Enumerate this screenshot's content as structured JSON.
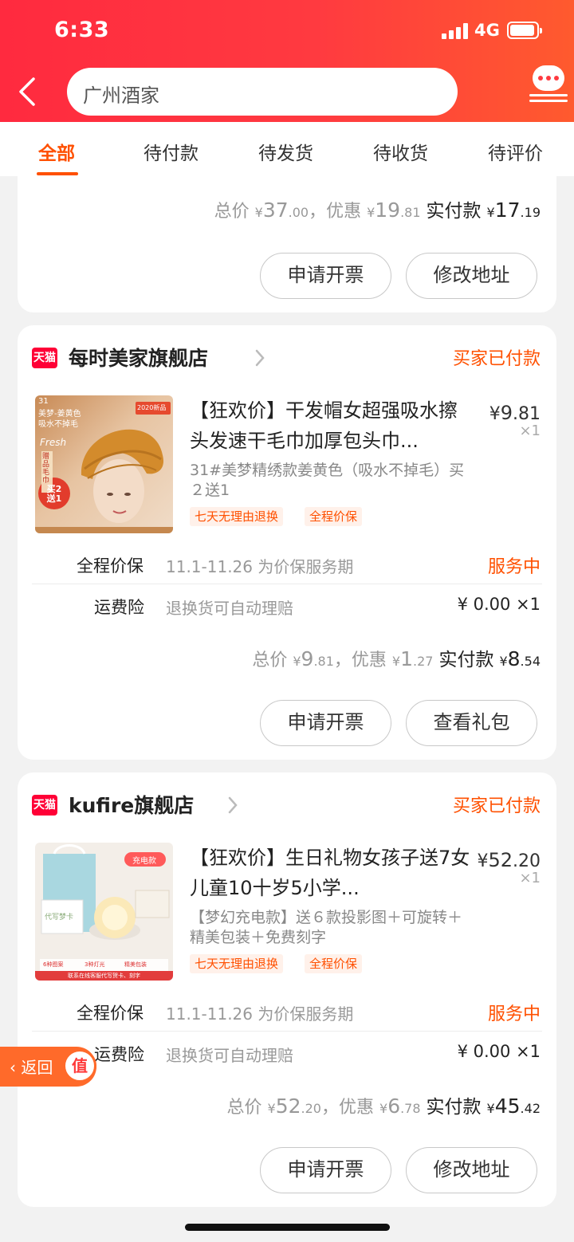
{
  "status_bar": {
    "time": "6:33",
    "network": "4G"
  },
  "header": {
    "search_text": "广州酒家"
  },
  "tabs": [
    {
      "label": "全部",
      "active": true
    },
    {
      "label": "待付款"
    },
    {
      "label": "待发货"
    },
    {
      "label": "待收货"
    },
    {
      "label": "待评价"
    }
  ],
  "order0": {
    "total_label": "总价",
    "total_yen": "¥",
    "total_int": "37",
    "total_dec": ".00",
    "discount_label": "，优惠",
    "discount_yen": "¥",
    "discount_int": "19",
    "discount_dec": ".81",
    "paid_label": "实付款",
    "paid_yen": "¥",
    "paid_int": "17",
    "paid_dec": ".19",
    "buttons": [
      "申请开票",
      "修改地址"
    ]
  },
  "order1": {
    "store_logo": "天猫",
    "store": "每时美家旗舰店",
    "status": "买家已付款",
    "title": "【狂欢价】干发帽女超强吸水擦头发速干毛巾加厚包头巾...",
    "price_yen": "¥",
    "price_int": "9",
    "price_dec": ".81",
    "qty": "×1",
    "spec": "31#美梦精绣款姜黄色（吸水不掉毛）买２送1",
    "tags": [
      "七天无理由退换",
      "全程价保"
    ],
    "thumb_text": {
      "line1": "31",
      "line2": "美梦-姜黄色",
      "line3": "吸水不掉毛",
      "badge": "2020新品",
      "fresh": "Fresh",
      "promo": "买2送1",
      "side": "赠品毛巾"
    },
    "service1": {
      "label": "全程价保",
      "desc": "11.1-11.26 为价保服务期",
      "status": "服务中"
    },
    "service2": {
      "label": "运费险",
      "desc": "退换货可自动理赔",
      "price": "¥ 0.00 ×1"
    },
    "total_label": "总价",
    "total_yen": "¥",
    "total_int": "9",
    "total_dec": ".81",
    "discount_label": "，优惠",
    "discount_yen": "¥",
    "discount_int": "1",
    "discount_dec": ".27",
    "paid_label": "实付款",
    "paid_yen": "¥",
    "paid_int": "8",
    "paid_dec": ".54",
    "buttons": [
      "申请开票",
      "查看礼包"
    ]
  },
  "order2": {
    "store_logo": "天猫",
    "store": "kufire旗舰店",
    "status": "买家已付款",
    "title": "【狂欢价】生日礼物女孩子送7女儿童10十岁5小学...",
    "price_yen": "¥",
    "price_int": "52",
    "price_dec": ".20",
    "qty": "×1",
    "spec": "【梦幻充电款】送６款投影图＋可旋转＋精美包装＋免费刻字",
    "tags": [
      "七天无理由退换",
      "全程价保"
    ],
    "thumb_text": {
      "badge": "充电款",
      "box": "代写梦卡",
      "chip1": "6种图案",
      "chip2": "3种灯光",
      "chip3": "精美包装",
      "footer": "联系在线客服代写贺卡、刻字"
    },
    "service1": {
      "label": "全程价保",
      "desc": "11.1-11.26 为价保服务期",
      "status": "服务中"
    },
    "service2": {
      "label": "运费险",
      "desc": "退换货可自动理赔",
      "price": "¥ 0.00 ×1"
    },
    "total_label": "总价",
    "total_yen": "¥",
    "total_int": "52",
    "total_dec": ".20",
    "discount_label": "，优惠",
    "discount_yen": "¥",
    "discount_int": "6",
    "discount_dec": ".78",
    "paid_label": "实付款",
    "paid_yen": "¥",
    "paid_int": "45",
    "paid_dec": ".42",
    "buttons": [
      "申请开票",
      "修改地址"
    ]
  },
  "float_back": {
    "label": "返回",
    "badge": "值"
  }
}
